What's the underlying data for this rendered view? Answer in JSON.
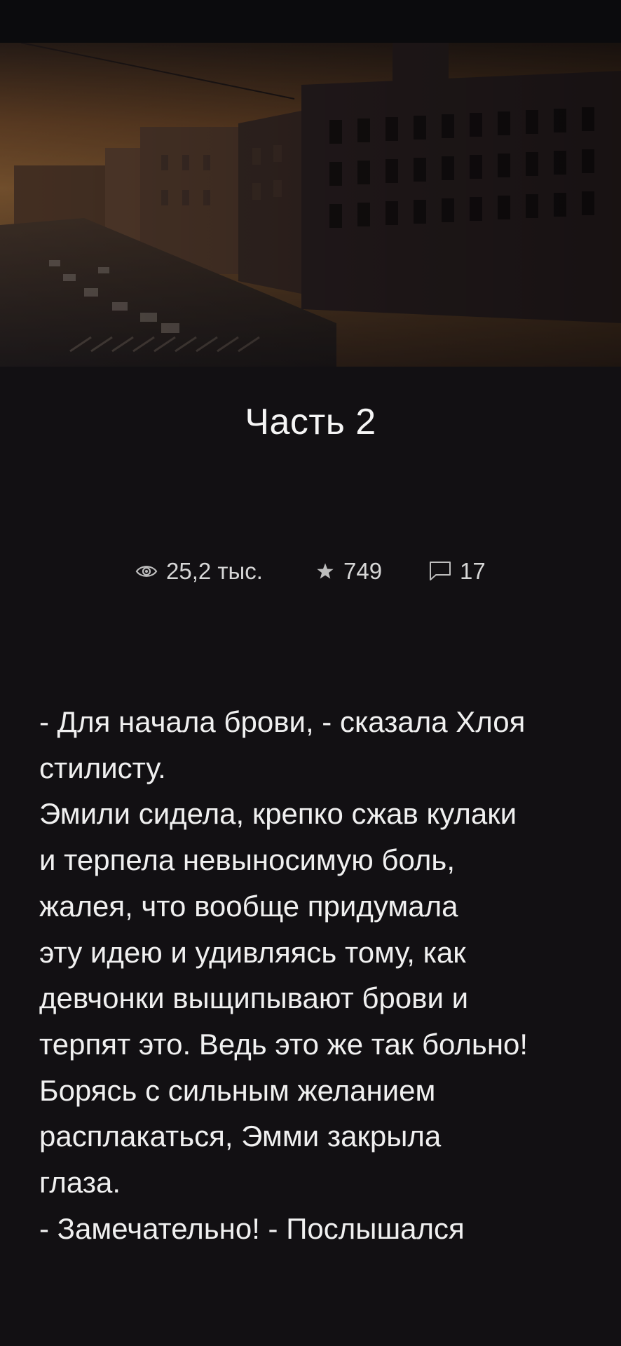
{
  "chapter": {
    "title": "Часть 2"
  },
  "stats": {
    "views": "25,2 тыс.",
    "votes": "749",
    "comments": "17",
    "views_icon": "eye-icon",
    "votes_icon": "star-icon",
    "comments_icon": "comment-icon"
  },
  "story": {
    "lines": [
      "- Для начала брови, - сказала Хлоя",
      "стилисту.",
      "Эмили сидела, крепко сжав кулаки",
      "и терпела невыносимую боль,",
      "жалея, что вообще придумала",
      "эту идею и удивляясь тому, как",
      "девчонки выщипывают брови и",
      "терпят это. Ведь это же так больно!",
      "Борясь с сильным желанием",
      "расплакаться, Эмми закрыла",
      "глаза.",
      "- Замечательно! - Послышался"
    ]
  },
  "colors": {
    "background": "#121013",
    "text": "#f0f0f0",
    "muted": "#d6d6d6"
  }
}
